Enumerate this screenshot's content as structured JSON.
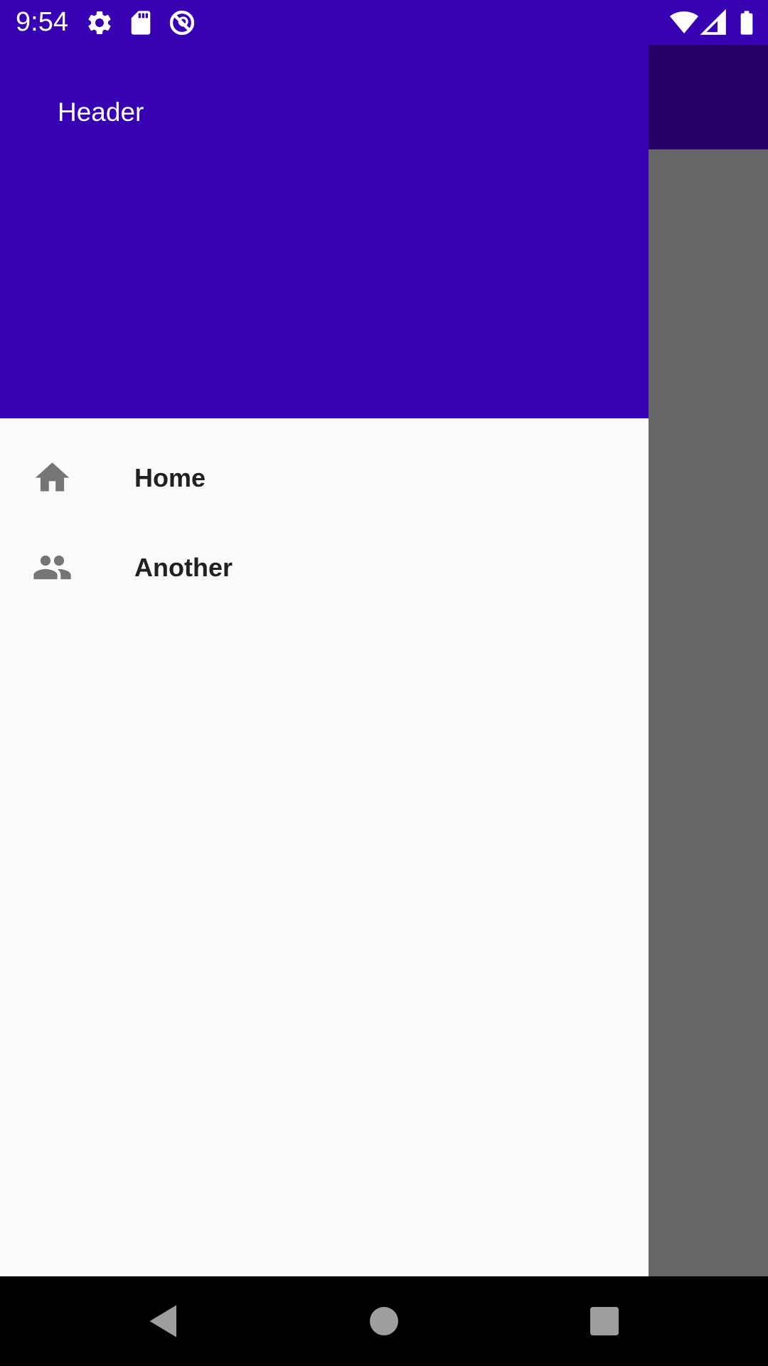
{
  "status_bar": {
    "time": "9:54",
    "left_icons": [
      "gear-icon",
      "sd-card-icon",
      "no-data-icon"
    ],
    "right_icons": [
      "wifi-icon",
      "cell-signal-icon",
      "battery-icon"
    ]
  },
  "drawer": {
    "header_title": "Header",
    "items": [
      {
        "label": "Home",
        "icon": "home-icon"
      },
      {
        "label": "Another",
        "icon": "people-icon"
      }
    ]
  },
  "system_nav": {
    "buttons": [
      "back-icon",
      "home-circle-icon",
      "recents-icon"
    ]
  },
  "colors": {
    "primary": "#3700B3",
    "primary_dark_scrim": "#270068",
    "scrim": "#666666",
    "drawer_bg": "#fafafa",
    "icon_gray": "#757575"
  }
}
